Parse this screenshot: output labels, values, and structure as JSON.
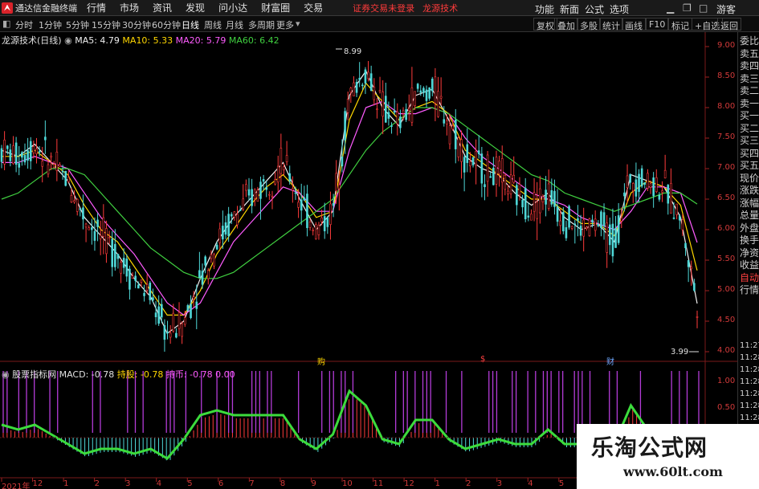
{
  "menubar": {
    "app_title": "通达信金融终端",
    "items": [
      "行情",
      "市场",
      "资讯",
      "发现",
      "问小达",
      "财富圈",
      "交易"
    ],
    "login_warning": "证券交易未登录",
    "brand": "龙源技术",
    "right_items": [
      "功能",
      "新面",
      "公式",
      "选项"
    ],
    "guest": "游客"
  },
  "periodbar": {
    "periods": [
      "分时",
      "1分钟",
      "5分钟",
      "15分钟",
      "30分钟",
      "60分钟",
      "日线",
      "周线",
      "月线",
      "多周期",
      "更多"
    ],
    "active_period": "日线",
    "tools": [
      "复权",
      "叠加",
      "多股",
      "统计",
      "画线",
      "F10",
      "标记",
      "+自选",
      "返回"
    ]
  },
  "main_chart": {
    "stock_label": "龙源技术(日线)",
    "ma5": "MA5: 4.79",
    "ma10": "MA10: 5.33",
    "ma20": "MA20: 5.79",
    "ma60": "MA60: 6.42",
    "high_label": "8.99",
    "low_label": "3.99",
    "events": [
      "购",
      "$",
      "财"
    ]
  },
  "sub_chart": {
    "indicator": "股票指标网",
    "macd": "MACD: -0.78",
    "chiguo": "持股: -0.78",
    "chibi": "持币: -0.78",
    "zero": "0.00",
    "yticks": [
      "1.00",
      "0.50"
    ]
  },
  "right_panel": {
    "items": [
      "委比",
      "卖五",
      "卖四",
      "卖三",
      "卖二",
      "卖一",
      "买一",
      "买二",
      "买三",
      "买四",
      "买五",
      "现价",
      "涨跌",
      "涨幅",
      "总量",
      "外盘",
      "换手",
      "净资",
      "收益",
      "自动",
      "行情"
    ],
    "highlight": [
      "自动"
    ],
    "times": [
      "11:27",
      "11:28",
      "11:28",
      "11:28",
      "11:28",
      "11:28",
      "11:28",
      "11:28",
      "11:28",
      "11:28"
    ]
  },
  "watermark": {
    "title": "乐淘公式网",
    "url": "www.60lt.com"
  },
  "chart_data": {
    "type": "line",
    "title": "",
    "xlabel": "",
    "ylabel": "",
    "x_tick_labels": [
      "2021年",
      "12",
      "1",
      "2",
      "3",
      "4",
      "5",
      "6",
      "7",
      "8",
      "9",
      "10",
      "11",
      "12",
      "1",
      "2",
      "3",
      "4",
      "5",
      "6",
      "7",
      "8",
      "9"
    ],
    "ylim": [
      4.0,
      9.0
    ],
    "y_ticks": [
      9.0,
      8.5,
      8.0,
      7.5,
      7.0,
      6.5,
      6.0,
      5.5,
      5.0,
      4.5,
      4.0
    ],
    "series": [
      {
        "name": "MA5",
        "color": "#f0f0f0",
        "values": [
          7.3,
          7.2,
          7.4,
          7.1,
          6.8,
          6.2,
          5.9,
          5.6,
          5.2,
          4.9,
          4.3,
          4.5,
          5.2,
          5.8,
          6.2,
          6.5,
          6.8,
          7.1,
          6.5,
          6.0,
          6.3,
          8.2,
          8.6,
          8.0,
          7.7,
          8.2,
          8.3,
          7.8,
          7.2,
          7.0,
          6.9,
          6.6,
          6.4,
          6.6,
          6.2,
          6.0,
          6.1,
          5.8,
          6.9,
          6.8,
          6.7,
          6.2,
          4.79
        ]
      },
      {
        "name": "MA10",
        "color": "#ffd700",
        "values": [
          7.2,
          7.2,
          7.3,
          7.1,
          6.9,
          6.4,
          6.0,
          5.8,
          5.4,
          5.0,
          4.6,
          4.6,
          5.0,
          5.6,
          6.0,
          6.4,
          6.7,
          6.9,
          6.6,
          6.2,
          6.3,
          7.8,
          8.4,
          8.1,
          7.8,
          8.0,
          8.1,
          7.9,
          7.3,
          7.1,
          6.9,
          6.7,
          6.5,
          6.5,
          6.3,
          6.1,
          6.1,
          5.9,
          6.6,
          6.8,
          6.7,
          6.4,
          5.33
        ]
      },
      {
        "name": "MA20",
        "color": "#ff5cff",
        "values": [
          7.1,
          7.1,
          7.2,
          7.1,
          7.0,
          6.6,
          6.2,
          5.9,
          5.6,
          5.2,
          4.8,
          4.6,
          4.8,
          5.3,
          5.8,
          6.1,
          6.4,
          6.7,
          6.6,
          6.3,
          6.3,
          7.3,
          8.0,
          8.1,
          7.9,
          7.9,
          8.0,
          7.9,
          7.5,
          7.2,
          7.0,
          6.8,
          6.6,
          6.5,
          6.4,
          6.2,
          6.1,
          6.0,
          6.3,
          6.7,
          6.7,
          6.6,
          5.79
        ]
      },
      {
        "name": "MA60",
        "color": "#40d040",
        "values": [
          6.5,
          6.6,
          6.8,
          7.0,
          7.0,
          6.9,
          6.6,
          6.3,
          6.0,
          5.7,
          5.5,
          5.3,
          5.2,
          5.2,
          5.3,
          5.5,
          5.7,
          5.9,
          6.1,
          6.3,
          6.5,
          6.9,
          7.3,
          7.6,
          7.8,
          8.0,
          8.0,
          7.9,
          7.7,
          7.5,
          7.3,
          7.1,
          6.9,
          6.8,
          6.6,
          6.5,
          6.4,
          6.3,
          6.4,
          6.5,
          6.6,
          6.6,
          6.42
        ]
      }
    ]
  }
}
